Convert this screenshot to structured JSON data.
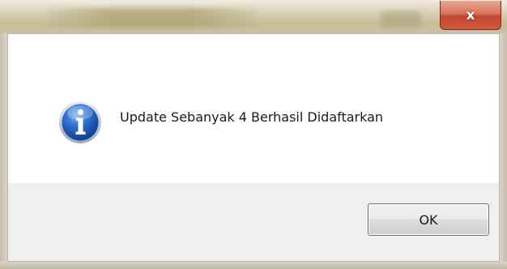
{
  "titlebar": {
    "close_glyph": "x",
    "close_icon": "close-icon"
  },
  "dialog": {
    "icon": "info-icon",
    "message": "Update Sebanyak 4 Berhasil Didaftarkan",
    "ok_label": "OK"
  },
  "colors": {
    "close_button": "#c3452f",
    "info_icon": "#1f5bb5",
    "content_bg": "#ffffff",
    "footer_bg": "#f0f0f0"
  }
}
